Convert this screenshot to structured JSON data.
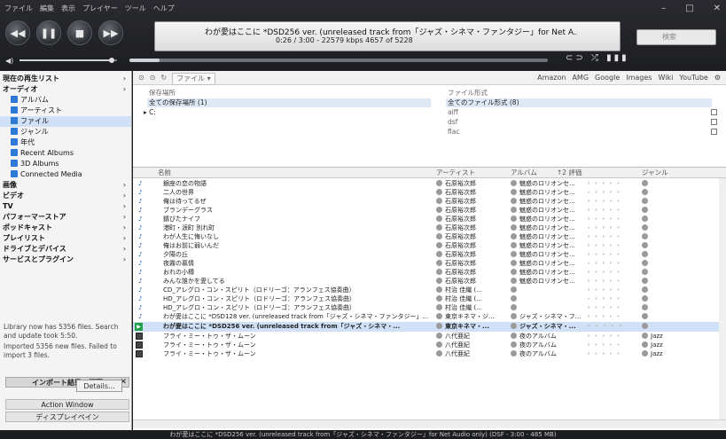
{
  "menu": [
    "ファイル",
    "編集",
    "表示",
    "プレイヤー",
    "ツール",
    "ヘルプ"
  ],
  "window_controls": [
    "–",
    "□",
    "✕"
  ],
  "now_playing": {
    "title": "わが愛はここに *DSD256 ver. (unreleased track from「ジャズ・シネマ・ファンタジー」for Net A...",
    "info": "0:26 / 3:00 - 22579 kbps  4657 of 5228",
    "search_placeholder": "検索"
  },
  "player_buttons": [
    "◀◀",
    "❚❚",
    "■",
    "▶▶"
  ],
  "mode_icons": "⊂⊃ ⤮ ▮▮▮",
  "sidebar": {
    "header": "現在の再生リスト",
    "items": [
      {
        "label": "オーディオ",
        "bold": true
      },
      {
        "label": "アルバム",
        "indent": 1
      },
      {
        "label": "アーティスト",
        "indent": 1
      },
      {
        "label": "ファイル",
        "indent": 1,
        "selected": true
      },
      {
        "label": "ジャンル",
        "indent": 1
      },
      {
        "label": "年代",
        "indent": 1
      },
      {
        "label": "Recent Albums",
        "indent": 1
      },
      {
        "label": "3D Albums",
        "indent": 1
      },
      {
        "label": "Connected Media",
        "indent": 1
      },
      {
        "label": "画像",
        "bold": true
      },
      {
        "label": "ビデオ",
        "bold": true
      },
      {
        "label": "TV",
        "bold": true
      },
      {
        "label": "パフォーマーストア",
        "bold": true
      },
      {
        "label": "ポッドキャスト",
        "bold": true
      },
      {
        "label": "プレイリスト",
        "bold": true
      },
      {
        "label": "ドライブとデバイス",
        "bold": true
      },
      {
        "label": "サービスとプラグイン",
        "bold": true
      }
    ],
    "import_header": "インポート結果の概要",
    "import_text1": "Library now has 5356 files. Search and update took 5:50.",
    "import_text2": "Imported 5356 new files. Failed to import 3 files.",
    "details_button": "Details...",
    "action_window": "Action Window",
    "display_window": "ディスプレイペイン"
  },
  "toolbar": {
    "file_button": "ファイル ▾",
    "links": [
      "Amazon",
      "AMG",
      "Google",
      "Images",
      "Wiki",
      "YouTube"
    ]
  },
  "filters": {
    "location_header": "保存場所",
    "location_items": [
      "全ての保存場所 (1)",
      "C:"
    ],
    "format_header": "ファイル形式",
    "format_items": [
      "全てのファイル形式 (8)",
      "aiff",
      "dsf",
      "flac"
    ]
  },
  "columns": [
    "名前",
    "アーティスト",
    "アルバム",
    "↑2 評価",
    "ジャンル"
  ],
  "tracks": [
    {
      "name": "銀座の恋の物語",
      "artist": "石原裕次郎",
      "album": "魅惑のロリオンセ...",
      "genre": ""
    },
    {
      "name": "二人の世界",
      "artist": "石原裕次郎",
      "album": "魅惑のロリオンセ...",
      "genre": ""
    },
    {
      "name": "俺は待ってるぜ",
      "artist": "石原裕次郎",
      "album": "魅惑のロリオンセ...",
      "genre": ""
    },
    {
      "name": "ブランデーグラス",
      "artist": "石原裕次郎",
      "album": "魅惑のロリオンセ...",
      "genre": ""
    },
    {
      "name": "錆びたナイフ",
      "artist": "石原裕次郎",
      "album": "魅惑のロリオンセ...",
      "genre": ""
    },
    {
      "name": "港町・涙町 別れ町",
      "artist": "石原裕次郎",
      "album": "魅惑のロリオンセ...",
      "genre": ""
    },
    {
      "name": "わが人生に悔いなし",
      "artist": "石原裕次郎",
      "album": "魅惑のロリオンセ...",
      "genre": ""
    },
    {
      "name": "俺はお前に弱いんだ",
      "artist": "石原裕次郎",
      "album": "魅惑のロリオンセ...",
      "genre": ""
    },
    {
      "name": "夕陽の丘",
      "artist": "石原裕次郎",
      "album": "魅惑のロリオンセ...",
      "genre": ""
    },
    {
      "name": "夜霧の慕情",
      "artist": "石原裕次郎",
      "album": "魅惑のロリオンセ...",
      "genre": ""
    },
    {
      "name": "おれの小樽",
      "artist": "石原裕次郎",
      "album": "魅惑のロリオンセ...",
      "genre": ""
    },
    {
      "name": "みんな誰かを愛してる",
      "artist": "石原裕次郎",
      "album": "魅惑のロリオンセ...",
      "genre": ""
    },
    {
      "name": "CD_アレグロ・コン・スピリト（ロドリーゴ：アランフェス協奏曲）",
      "artist": "村治 佳織 (...",
      "album": "",
      "genre": ""
    },
    {
      "name": "HD_アレグロ・コン・スピリト（ロドリーゴ：アランフェス協奏曲）",
      "artist": "村治 佳織 (...",
      "album": "",
      "genre": ""
    },
    {
      "name": "HD_アレグロ・コン・スピリト（ロドリーゴ：アランフェス協奏曲）",
      "artist": "村治 佳織 (...",
      "album": "",
      "genre": ""
    },
    {
      "name": "わが愛はここに *DSD128 ver. (unreleased track from「ジャズ・シネマ・ファンタジー」...",
      "artist": "東京キネマ・ジ...",
      "album": "ジャズ・シネマ・フ...",
      "genre": ""
    },
    {
      "name": "わが愛はここに *DSD256 ver. (unreleased track from「ジャズ・シネマ・...",
      "artist": "東京キネマ・...",
      "album": "ジャズ・シネマ・...",
      "genre": "",
      "selected": true
    },
    {
      "name": "フライ・ミー・トゥ・ザ・ムーン",
      "artist": "八代亜紀",
      "album": "夜のアルバム",
      "genre": "Jazz"
    },
    {
      "name": "フライ・ミー・トゥ・ザ・ムーン",
      "artist": "八代亜紀",
      "album": "夜のアルバム",
      "genre": "Jazz"
    },
    {
      "name": "フライ・ミー・トゥ・ザ・ムーン",
      "artist": "八代亜紀",
      "album": "夜のアルバム",
      "genre": "Jazz"
    }
  ],
  "status_bar": "わが愛はここに *DSD256 ver. (unreleased track from「ジャズ・シネマ・ファンタジー」for Net Audio only)  (DSF - 3:00 - 485 MB)"
}
